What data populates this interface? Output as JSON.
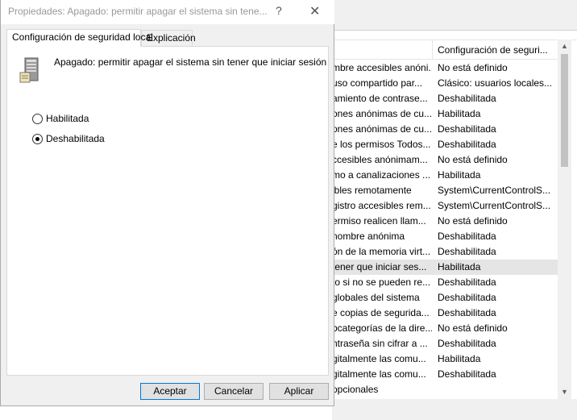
{
  "dialog": {
    "title": "Propiedades: Apagado: permitir apagar el sistema sin tene...",
    "help_glyph": "?",
    "close_glyph": "✕",
    "tabs": [
      {
        "label": "Configuración de seguridad local",
        "active": true
      },
      {
        "label": "Explicación",
        "active": false
      }
    ],
    "policy_name": "Apagado: permitir apagar el sistema sin tener que iniciar sesión",
    "options": [
      {
        "label": "Habilitada",
        "checked": false
      },
      {
        "label": "Deshabilitada",
        "checked": true
      }
    ],
    "buttons": {
      "ok": "Aceptar",
      "cancel": "Cancelar",
      "apply": "Aplicar"
    }
  },
  "policy_list": {
    "column_header": "Configuración de seguri...",
    "rows": [
      {
        "policy": "mbre accesibles anóni...",
        "setting": "No está definido"
      },
      {
        "policy": "uso compartido par...",
        "setting": "Clásico: usuarios locales..."
      },
      {
        "policy": "amiento de contrase...",
        "setting": "Deshabilitada"
      },
      {
        "policy": "ones anónimas de cu...",
        "setting": "Habilitada"
      },
      {
        "policy": "ones anónimas de cu...",
        "setting": "Deshabilitada"
      },
      {
        "policy": "e los permisos Todos...",
        "setting": "Deshabilitada"
      },
      {
        "policy": "ccesibles anónimam...",
        "setting": "No está definido"
      },
      {
        "policy": "mo a canalizaciones ...",
        "setting": "Habilitada"
      },
      {
        "policy": "ibles remotamente",
        "setting": "System\\CurrentControlS..."
      },
      {
        "policy": "gistro accesibles rem...",
        "setting": "System\\CurrentControlS..."
      },
      {
        "policy": "ermiso realicen llam...",
        "setting": "No está definido"
      },
      {
        "policy": "nombre anónima",
        "setting": "Deshabilitada"
      },
      {
        "policy": "ón de la memoria virt...",
        "setting": "Deshabilitada"
      },
      {
        "policy": "tener que iniciar ses...",
        "setting": "Habilitada",
        "selected": true
      },
      {
        "policy": "to si no se pueden re...",
        "setting": "Deshabilitada"
      },
      {
        "policy": "globales del sistema",
        "setting": "Deshabilitada"
      },
      {
        "policy": "e copias de segurida...",
        "setting": "Deshabilitada"
      },
      {
        "policy": "bcategorías de la dire...",
        "setting": "No está definido"
      },
      {
        "policy": "ntraseña sin cifrar a ...",
        "setting": "Deshabilitada"
      },
      {
        "policy": "gitalmente las comu...",
        "setting": "Habilitada"
      },
      {
        "policy": "gitalmente las comu...",
        "setting": "Deshabilitada"
      },
      {
        "policy": "opcionales",
        "setting": ""
      }
    ]
  },
  "colors": {
    "accent": "#0078d7",
    "selected_row": "#e5e5e5",
    "dialog_bg": "#f0f0f0"
  }
}
